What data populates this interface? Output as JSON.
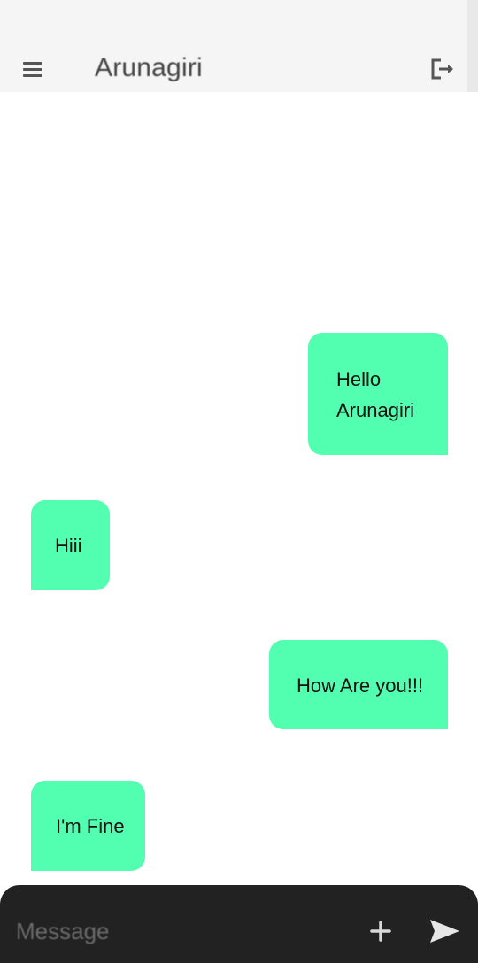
{
  "app_bar": {
    "title": "Arunagiri",
    "menu_icon": "menu-icon",
    "logout_icon": "logout-icon"
  },
  "messages": [
    {
      "direction": "sent",
      "text": "Hello Arunagiri"
    },
    {
      "direction": "received",
      "text": "Hiii"
    },
    {
      "direction": "sent",
      "text": "How Are you!!!"
    },
    {
      "direction": "received",
      "text": "I'm Fine"
    }
  ],
  "composer": {
    "placeholder": "Message",
    "value": "",
    "attach_icon": "plus-icon",
    "send_icon": "send-icon"
  },
  "colors": {
    "bubble": "#52ffb0",
    "composer_bg": "#222222",
    "app_bar_bg": "#f5f5f5"
  }
}
